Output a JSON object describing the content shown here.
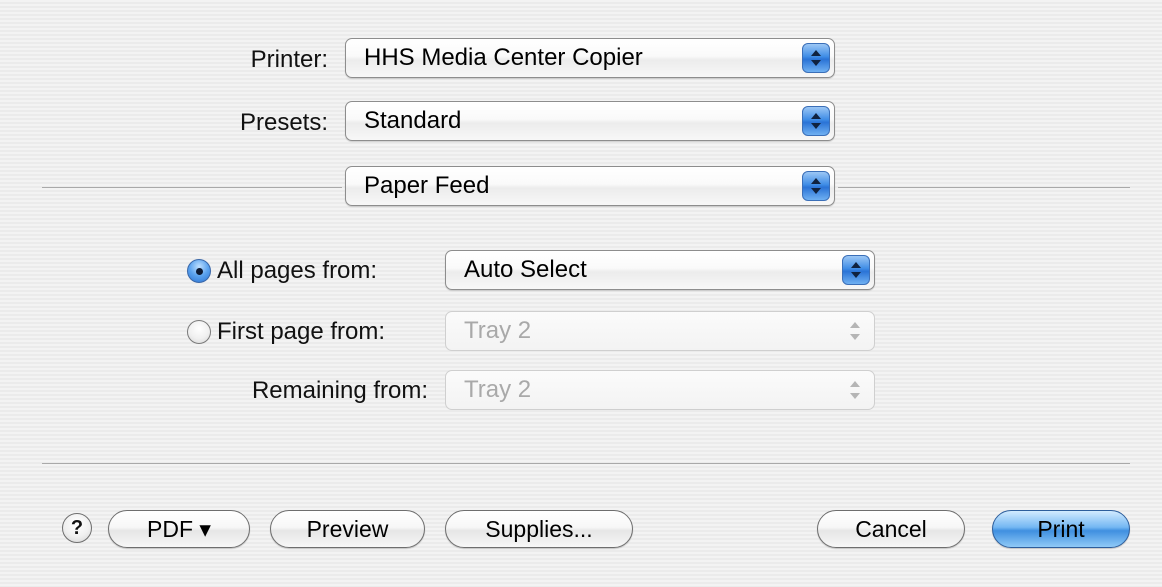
{
  "printer": {
    "label": "Printer:",
    "value": "HHS Media Center Copier"
  },
  "presets": {
    "label": "Presets:",
    "value": "Standard"
  },
  "panel": {
    "value": "Paper Feed"
  },
  "paper_feed": {
    "all_pages": {
      "label": "All pages from:",
      "value": "Auto Select",
      "selected": true
    },
    "first_page": {
      "label": "First page from:",
      "value": "Tray 2",
      "enabled": false
    },
    "remaining": {
      "label": "Remaining from:",
      "value": "Tray 2",
      "enabled": false
    }
  },
  "footer": {
    "help_label": "?",
    "pdf_label": "PDF ▾",
    "preview_label": "Preview",
    "supplies_label": "Supplies...",
    "cancel_label": "Cancel",
    "print_label": "Print"
  },
  "colors": {
    "accent": "#3f8fe0",
    "background": "#efefef"
  }
}
